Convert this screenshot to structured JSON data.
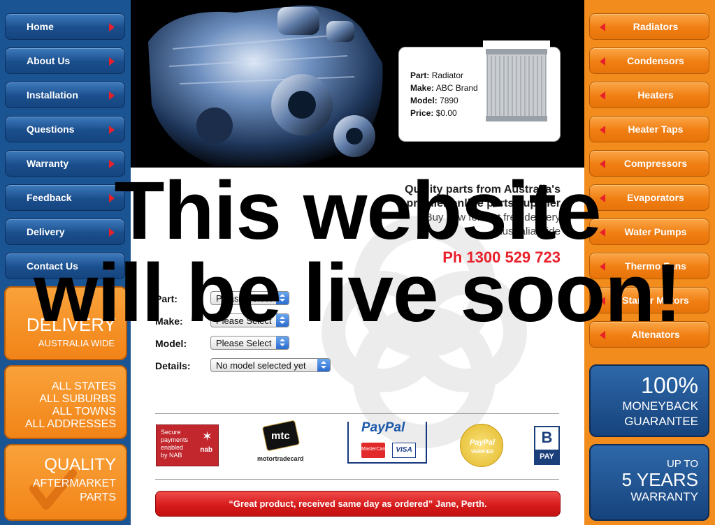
{
  "left_nav": [
    {
      "label": "Home"
    },
    {
      "label": "About Us"
    },
    {
      "label": "Installation"
    },
    {
      "label": "Questions"
    },
    {
      "label": "Warranty"
    },
    {
      "label": "Feedback"
    },
    {
      "label": "Delivery"
    },
    {
      "label": "Contact Us"
    }
  ],
  "left_promos": {
    "delivery": {
      "line1": "DELIVERY",
      "line2": "AUSTRALIA WIDE"
    },
    "coverage": {
      "line1": "ALL STATES",
      "line2": "ALL SUBURBS",
      "line3": "ALL TOWNS",
      "line4": "ALL ADDRESSES"
    },
    "quality": {
      "line1": "QUALITY",
      "line2": "AFTERMARKET",
      "line3": "PARTS"
    }
  },
  "right_nav": [
    {
      "label": "Radiators"
    },
    {
      "label": "Condensors"
    },
    {
      "label": "Heaters"
    },
    {
      "label": "Heater Taps"
    },
    {
      "label": "Compressors"
    },
    {
      "label": "Evaporators"
    },
    {
      "label": "Water Pumps"
    },
    {
      "label": "Thermo Fans"
    },
    {
      "label": "Starter Motors"
    },
    {
      "label": "Altenators"
    }
  ],
  "right_promos": {
    "moneyback": {
      "line1": "100%",
      "line2": "MONEYBACK",
      "line3": "GUARANTEE"
    },
    "warranty": {
      "line1": "UP TO",
      "line2": "5 YEARS",
      "line3": "WARRANTY"
    }
  },
  "part_card": {
    "part_label": "Part:",
    "part_value": "Radiator",
    "make_label": "Make:",
    "make_value": "ABC Brand",
    "model_label": "Model:",
    "model_value": "7890",
    "price_label": "Price:",
    "price_value": "$0.00"
  },
  "tagline": {
    "line1": "Quality parts from Australia's",
    "line2": "premier online parts supplier",
    "line3": "Buy now for fast free delivery",
    "line4": "Australia wide",
    "phone": "Ph 1300 529 723"
  },
  "search_form": {
    "part_label": "Part:",
    "part_value": "Please Select",
    "make_label": "Make:",
    "make_value": "Please Select",
    "model_label": "Model:",
    "model_value": "Please Select",
    "details_label": "Details:",
    "details_value": "No model selected yet"
  },
  "payment_logos": {
    "nab": {
      "line1": "Secure",
      "line2": "payments",
      "line3": "enabled",
      "line4": "by NAB",
      "brand": "nab"
    },
    "mtc": {
      "brand": "mtc",
      "caption": "motortradecard"
    },
    "paypal": {
      "brand": "PayPal",
      "card1": "MasterCard",
      "card2": "VISA"
    },
    "paypal_verified": {
      "brand": "PayPal",
      "caption": "VERIFIED"
    },
    "bpay": {
      "brand": "PAY"
    }
  },
  "testimonial": "“Great product, received same day as ordered” Jane, Perth.",
  "overlay": {
    "line1": "This website",
    "line2": "will be live soon!"
  },
  "colors": {
    "nav_blue": "#1b5493",
    "nav_orange": "#f28c1c",
    "accent_red": "#e8202a",
    "phone_red": "#e8202a"
  }
}
